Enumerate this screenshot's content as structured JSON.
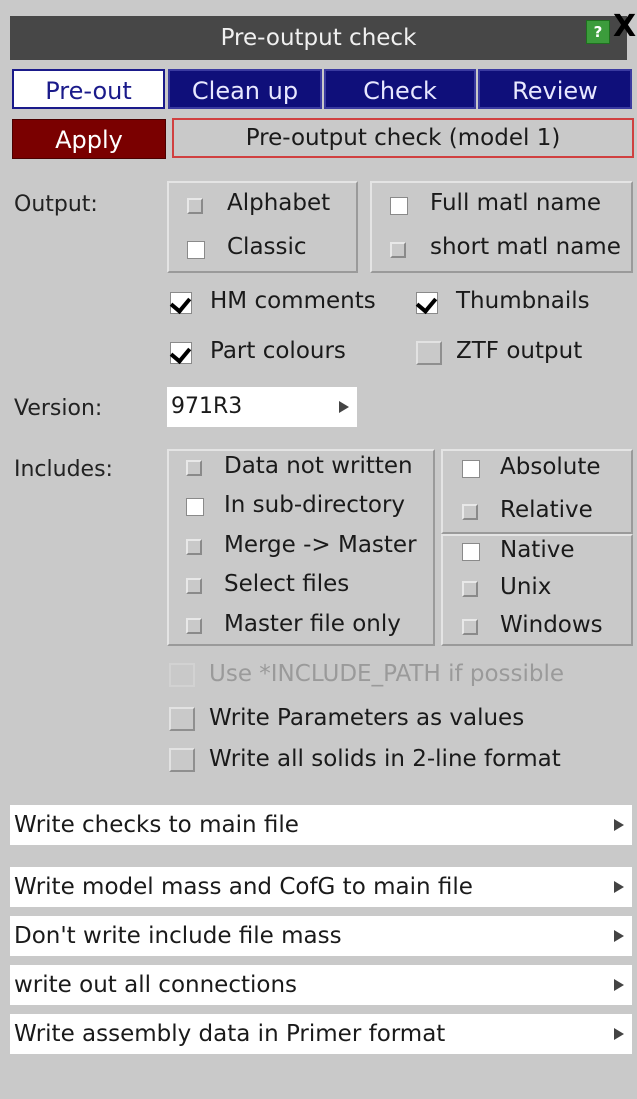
{
  "window": {
    "title": "Pre-output check",
    "help_label": "?",
    "close_label": "X"
  },
  "tabs": [
    {
      "label": "Pre-out",
      "active": true
    },
    {
      "label": "Clean up",
      "active": false
    },
    {
      "label": "Check",
      "active": false
    },
    {
      "label": "Review",
      "active": false
    }
  ],
  "apply_label": "Apply",
  "model_label": "Pre-output check (model 1)",
  "output": {
    "label": "Output:",
    "alphabet": "Alphabet",
    "classic": "Classic",
    "full_matl": "Full matl name",
    "short_matl": "short matl name",
    "hm_comments": "HM comments",
    "thumbnails": "Thumbnails",
    "part_colours": "Part colours",
    "ztf_output": "ZTF output"
  },
  "version": {
    "label": "Version:",
    "value": "971R3"
  },
  "includes": {
    "label": "Includes:",
    "data_not_written": "Data not written",
    "in_sub_directory": "In sub-directory",
    "merge_master": "Merge -> Master",
    "select_files": "Select files",
    "master_only": "Master file only",
    "absolute": "Absolute",
    "relative": "Relative",
    "native": "Native",
    "unix": "Unix",
    "windows": "Windows"
  },
  "options": {
    "include_path": "Use *INCLUDE_PATH if possible",
    "params_values": "Write Parameters as values",
    "solids_2line": "Write all solids in 2-line format"
  },
  "dropdowns": [
    "Write checks to main file",
    "Write model mass and CofG to main file",
    "Don't write include file mass",
    "write out all connections",
    "Write assembly data in Primer format"
  ],
  "colors": {
    "titlebar": "#474747",
    "tab_active": "#ffffff",
    "tab_inactive": "#0f0f7a",
    "apply": "#7a0000",
    "panel_bg": "#c9c9c9"
  }
}
